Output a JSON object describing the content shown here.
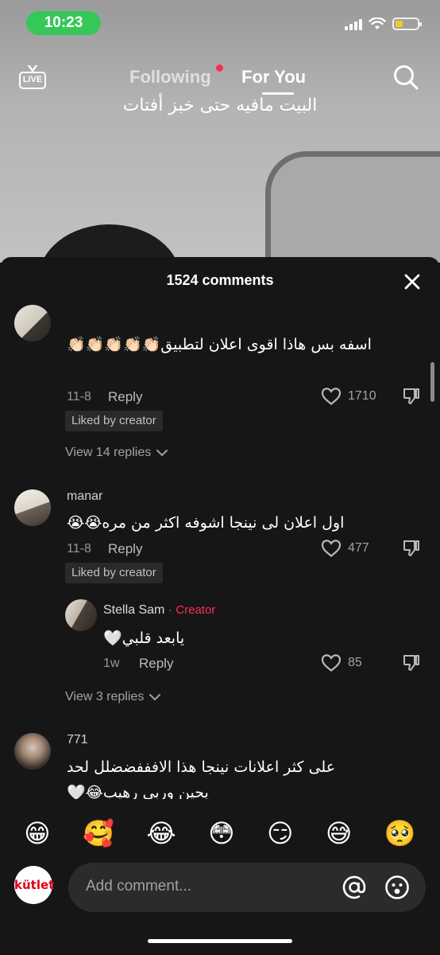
{
  "status": {
    "time": "10:23"
  },
  "nav": {
    "live_label": "LIVE",
    "tab_following": "Following",
    "tab_foryou": "For You",
    "video_caption": "البيت مافيه حتى خبز أفتات"
  },
  "sheet": {
    "title": "1524 comments",
    "comments": [
      {
        "text": "اسفه بس هاذا اقوى اعلان لتطبيق👏🏻👏🏻👏🏻👏🏻👏🏻",
        "date": "11-8",
        "reply": "Reply",
        "likes": "1710",
        "liked_badge": "Liked by creator",
        "view_replies": "View 14 replies"
      },
      {
        "username": "manar",
        "text": "اول اعلان لى نينجا اشوفه اكثر من مره😭😭",
        "date": "11-8",
        "reply": "Reply",
        "likes": "477",
        "liked_badge": "Liked by creator",
        "reply_item": {
          "username": "Stella Sam",
          "dot": "·",
          "creator_tag": "Creator",
          "text": "يابعد قلبي🤍",
          "date": "1w",
          "reply": "Reply",
          "likes": "85"
        },
        "view_replies": "View 3 replies"
      },
      {
        "username": "771",
        "text": "على كثر اعلانات نينجا هذا الافففضضلل لحد",
        "text2": "يحين وربي رهيب😂🤍"
      }
    ]
  },
  "emojis": [
    "😁",
    "🥰",
    "😂",
    "😳",
    "😏",
    "😅",
    "🥺"
  ],
  "input": {
    "placeholder": "Add comment...",
    "avatar_text": "kütlet"
  },
  "colors": {
    "accent": "#fe2c55",
    "status_green": "#36c759",
    "battery": "#ffd60a",
    "sheet_bg": "#161616"
  }
}
